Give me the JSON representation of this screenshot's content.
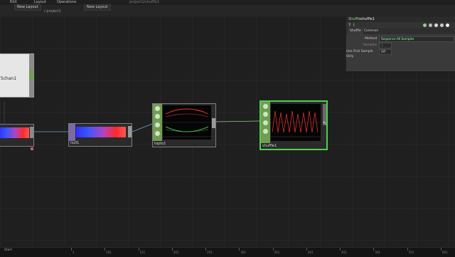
{
  "topbar": {
    "menu_items": [
      "Edit",
      "Layout",
      "Operations",
      "New Layout"
    ],
    "tab_name": "New Layout",
    "path": "/ project1",
    "right_tab": "New Layout",
    "expression_placeholder": "project1/shuffle1"
  },
  "nodes": {
    "chan_node": {
      "label": "75chan1"
    },
    "ramp_node": {
      "label": ""
    },
    "null_node": {
      "label": "null1"
    },
    "topto_node": {
      "label": "topto1"
    },
    "shuffle_node": {
      "label": "shuffle1"
    }
  },
  "panel": {
    "type": "Shuffle",
    "name": "shuffle1",
    "tabs": [
      "Shuffle",
      "Common"
    ],
    "params": [
      {
        "label": "Method",
        "value": "Sequence All Samples"
      },
      {
        "label": "Samples",
        "value": "1"
      },
      {
        "label": "Use First Sample Only",
        "value": "Off"
      }
    ]
  },
  "timeline": {
    "start_label": "Start",
    "ticks": [
      "1",
      "101",
      "151",
      "201",
      "251",
      "301",
      "351",
      "401",
      "451",
      "501",
      "551",
      "601"
    ]
  },
  "colors": {
    "node_border_selected": "#4fcf4f",
    "chop_green": "#6f9d52",
    "graph_red": "#ff3333",
    "graph_green": "#59e05a"
  }
}
